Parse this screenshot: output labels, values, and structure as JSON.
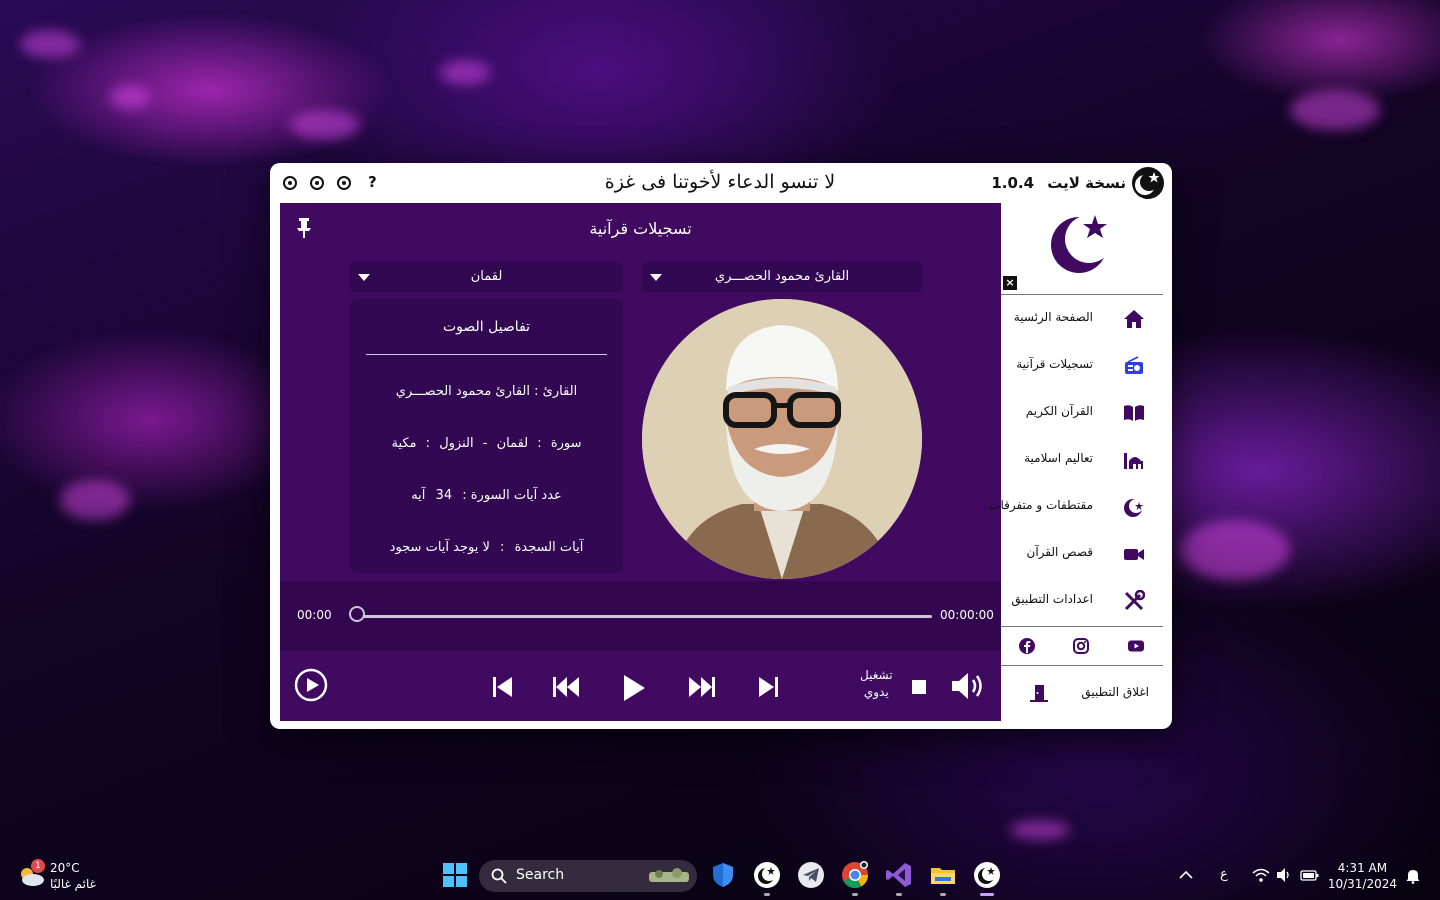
{
  "window": {
    "banner": "لا تنسو الدعاء لأخوتنا فى غزة",
    "brand": "نسخة لايت",
    "version": "1.0.4",
    "help": "?"
  },
  "page": {
    "title": "تسجيلات قرآنية",
    "reciter_select": "القارئ محمود الحصـــري",
    "surah_select": "لقمان"
  },
  "details": {
    "heading": "تفاصيل الصوت",
    "reciter_label": "القارئ :",
    "reciter_value": "القارئ محمود الحصـــري",
    "surah_label": "سورة",
    "surah_value": "لقمان",
    "dash": "-",
    "revelation_label": "النزول",
    "revelation_value": "مكية",
    "verses_label": "عدد آيات السورة :",
    "verses_value": "34",
    "verses_unit": "آيه",
    "sajda_label": "آيات السجدة",
    "sajda_value": "لا يوجد آيات سجود",
    "colon": ":"
  },
  "player": {
    "elapsed": "00:00",
    "total": "00:00:00",
    "progress": 0,
    "mode_line1": "تشغيل",
    "mode_line2": "يدوي"
  },
  "sidebar": {
    "items": [
      {
        "label": "الصفحة الرئسية",
        "icon": "home-icon"
      },
      {
        "label": "تسجيلات قرآنية",
        "icon": "radio-icon"
      },
      {
        "label": "القرآن الكريم",
        "icon": "book-icon"
      },
      {
        "label": "تعاليم اسلامية",
        "icon": "mosque-icon"
      },
      {
        "label": "مقتطفات و متفرقات",
        "icon": "crescent-icon"
      },
      {
        "label": "قصص القرآن",
        "icon": "video-icon"
      },
      {
        "label": "اعدادات التطبيق",
        "icon": "tools-icon"
      }
    ],
    "exit_label": "اغلاق التطبيق",
    "close": "×"
  },
  "taskbar": {
    "temperature": "20°C",
    "weather": "غائم غالبًا",
    "weather_badge": "1",
    "search": "Search",
    "lang": "ع",
    "time": "4:31 AM",
    "date": "10/31/2024"
  },
  "colors": {
    "accent": "#3f0a60",
    "panel": "#330852"
  }
}
